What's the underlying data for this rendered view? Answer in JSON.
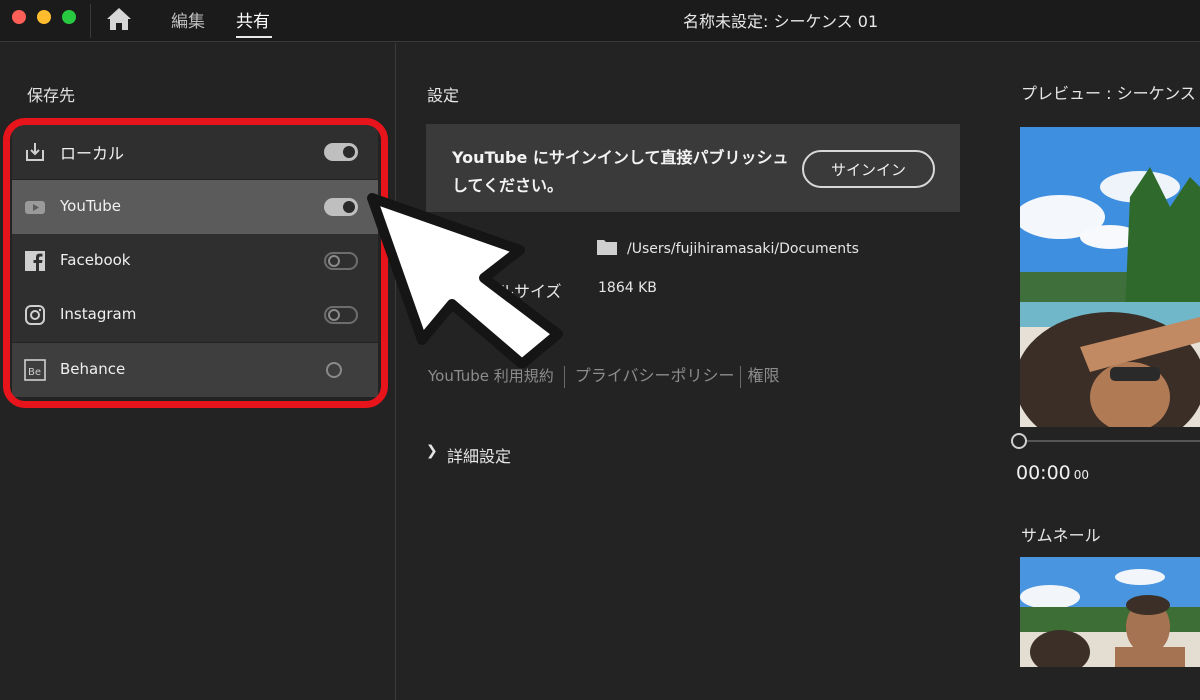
{
  "topbar": {
    "nav": [
      {
        "label": "編集"
      },
      {
        "label": "共有"
      }
    ],
    "window_title": "名称未設定: シーケンス 01"
  },
  "left": {
    "section_label": "保存先",
    "destinations": [
      {
        "name": "ローカル",
        "icon": "download-icon",
        "state": "on"
      },
      {
        "name": "YouTube",
        "icon": "youtube-icon",
        "state": "on"
      },
      {
        "name": "Facebook",
        "icon": "facebook-icon",
        "state": "off"
      },
      {
        "name": "Instagram",
        "icon": "instagram-icon",
        "state": "off"
      },
      {
        "name": "Behance",
        "icon": "behance-icon",
        "state": "off"
      }
    ]
  },
  "settings": {
    "label": "設定",
    "signin_message": "YouTube にサインインして直接パブリッシュしてください。",
    "signin_button": "サインイン",
    "path": "/Users/fujihiramasaki/Documents",
    "filesize_label": "ルサイズ",
    "filesize_value": "1864 KB",
    "links": [
      "YouTube 利用規約",
      "プライバシーポリシー",
      "権限"
    ],
    "advanced_label": "詳細設定"
  },
  "preview": {
    "label": "プレビュー : シーケンス",
    "timecode": "00:00",
    "timecode_frames": "00",
    "thumbnail_label": "サムネール"
  },
  "colors": {
    "highlight": "#e8141c",
    "selected_row": "#5b5b5b",
    "background": "#232323"
  }
}
